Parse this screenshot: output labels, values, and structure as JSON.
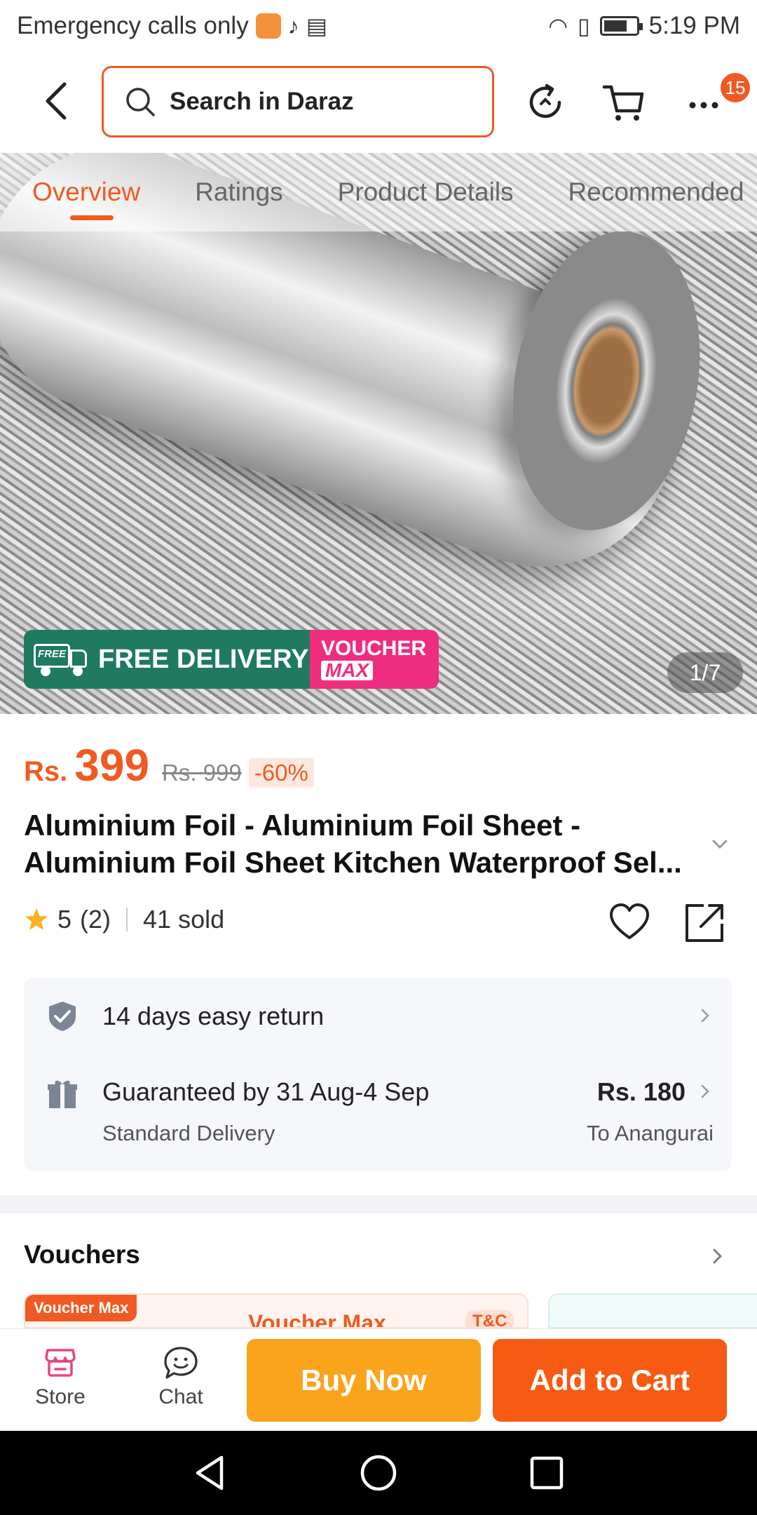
{
  "status_bar": {
    "carrier": "Emergency calls only",
    "time": "5:19 PM"
  },
  "header": {
    "search_placeholder": "Search in Daraz",
    "cart_badge": "15"
  },
  "tabs": [
    {
      "label": "Overview",
      "active": true
    },
    {
      "label": "Ratings",
      "active": false
    },
    {
      "label": "Product Details",
      "active": false
    },
    {
      "label": "Recommended",
      "active": false
    }
  ],
  "gallery": {
    "promo_free_delivery": "FREE DELIVERY",
    "promo_free_tag": "FREE",
    "promo_voucher_line1": "VOUCHER",
    "promo_voucher_line2": "MAX",
    "counter": "1/7"
  },
  "product": {
    "currency": "Rs.",
    "price": "399",
    "old_price": "Rs. 999",
    "discount": "-60%",
    "title": "Aluminium Foil - Aluminium Foil Sheet - Aluminium Foil Sheet Kitchen Waterproof Sel...",
    "rating": "5",
    "rating_count": "(2)",
    "sold": "41 sold"
  },
  "services": {
    "return_text": "14 days easy return",
    "delivery_text": "Guaranteed by 31 Aug-4 Sep",
    "delivery_type": "Standard Delivery",
    "delivery_price": "Rs. 180",
    "delivery_destination": "To Anangurai"
  },
  "vouchers": {
    "title": "Vouchers",
    "card_tag": "Voucher Max",
    "card_name": "Voucher Max",
    "card_tc": "T&C"
  },
  "action_bar": {
    "store": "Store",
    "chat": "Chat",
    "buy_now": "Buy Now",
    "add_to_cart": "Add to Cart"
  },
  "colors": {
    "accent": "#f05a22",
    "buy_now": "#fba31b",
    "add_to_cart": "#f65a13",
    "free_delivery_bg": "#1f7a5f",
    "voucher_bg": "#ee2d7f"
  }
}
